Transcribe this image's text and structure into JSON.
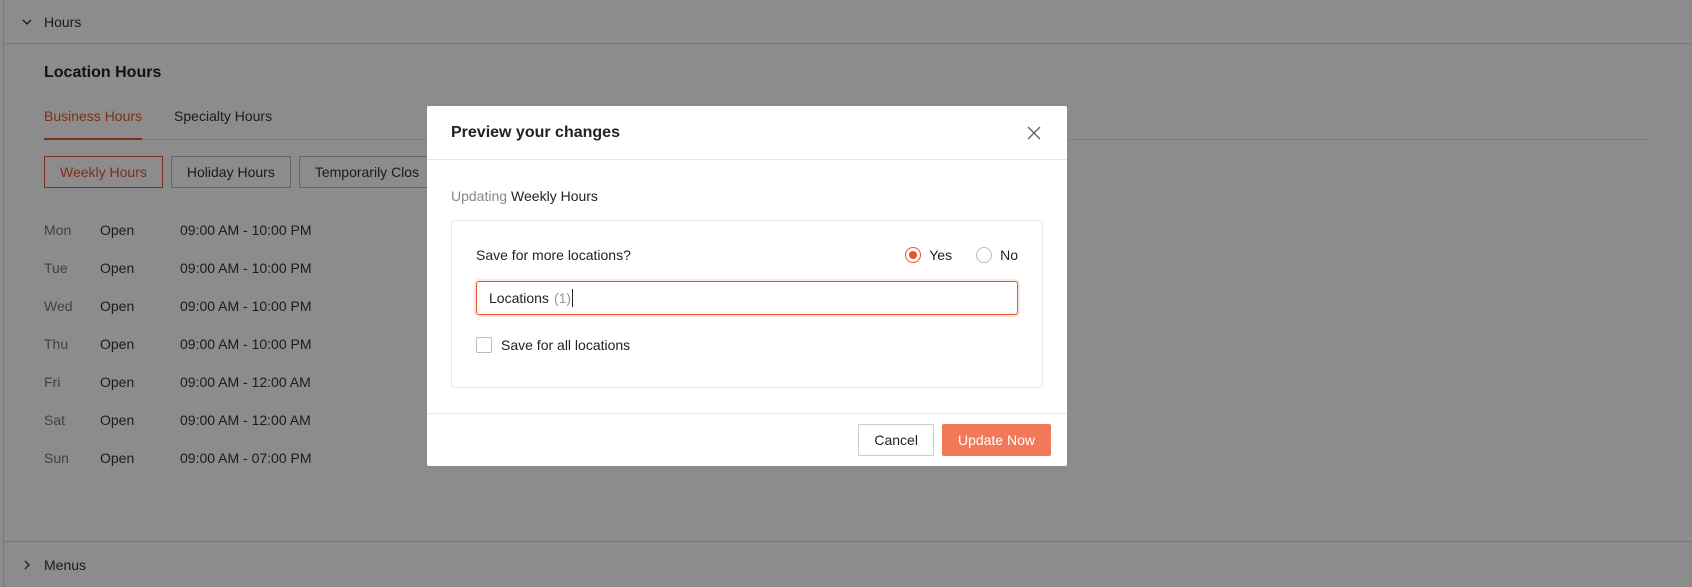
{
  "sections": {
    "hours_label": "Hours",
    "menus_label": "Menus"
  },
  "location_hours": {
    "title": "Location Hours",
    "tabs": [
      {
        "label": "Business Hours",
        "active": true
      },
      {
        "label": "Specialty Hours",
        "active": false
      }
    ],
    "subtabs": [
      {
        "label": "Weekly Hours",
        "active": true
      },
      {
        "label": "Holiday Hours",
        "active": false
      },
      {
        "label": "Temporarily Clos",
        "active": false
      }
    ],
    "rows": [
      {
        "day": "Mon",
        "status": "Open",
        "time": "09:00 AM - 10:00 PM"
      },
      {
        "day": "Tue",
        "status": "Open",
        "time": "09:00 AM - 10:00 PM"
      },
      {
        "day": "Wed",
        "status": "Open",
        "time": "09:00 AM - 10:00 PM"
      },
      {
        "day": "Thu",
        "status": "Open",
        "time": "09:00 AM - 10:00 PM"
      },
      {
        "day": "Fri",
        "status": "Open",
        "time": "09:00 AM - 12:00 AM"
      },
      {
        "day": "Sat",
        "status": "Open",
        "time": "09:00 AM - 12:00 AM"
      },
      {
        "day": "Sun",
        "status": "Open",
        "time": "09:00 AM - 07:00 PM"
      }
    ]
  },
  "modal": {
    "title": "Preview your changes",
    "close_icon": "close-icon",
    "updating_prefix": "Updating",
    "updating_target": "Weekly Hours",
    "question": "Save for more locations?",
    "radio_yes": "Yes",
    "radio_no": "No",
    "selected_radio": "Yes",
    "locations_value": "Locations",
    "locations_count": "(1)",
    "save_all_label": "Save for all locations",
    "save_all_checked": false,
    "cancel_label": "Cancel",
    "update_label": "Update Now"
  },
  "colors": {
    "accent": "#e4572e",
    "primary_button": "#f2785a"
  }
}
